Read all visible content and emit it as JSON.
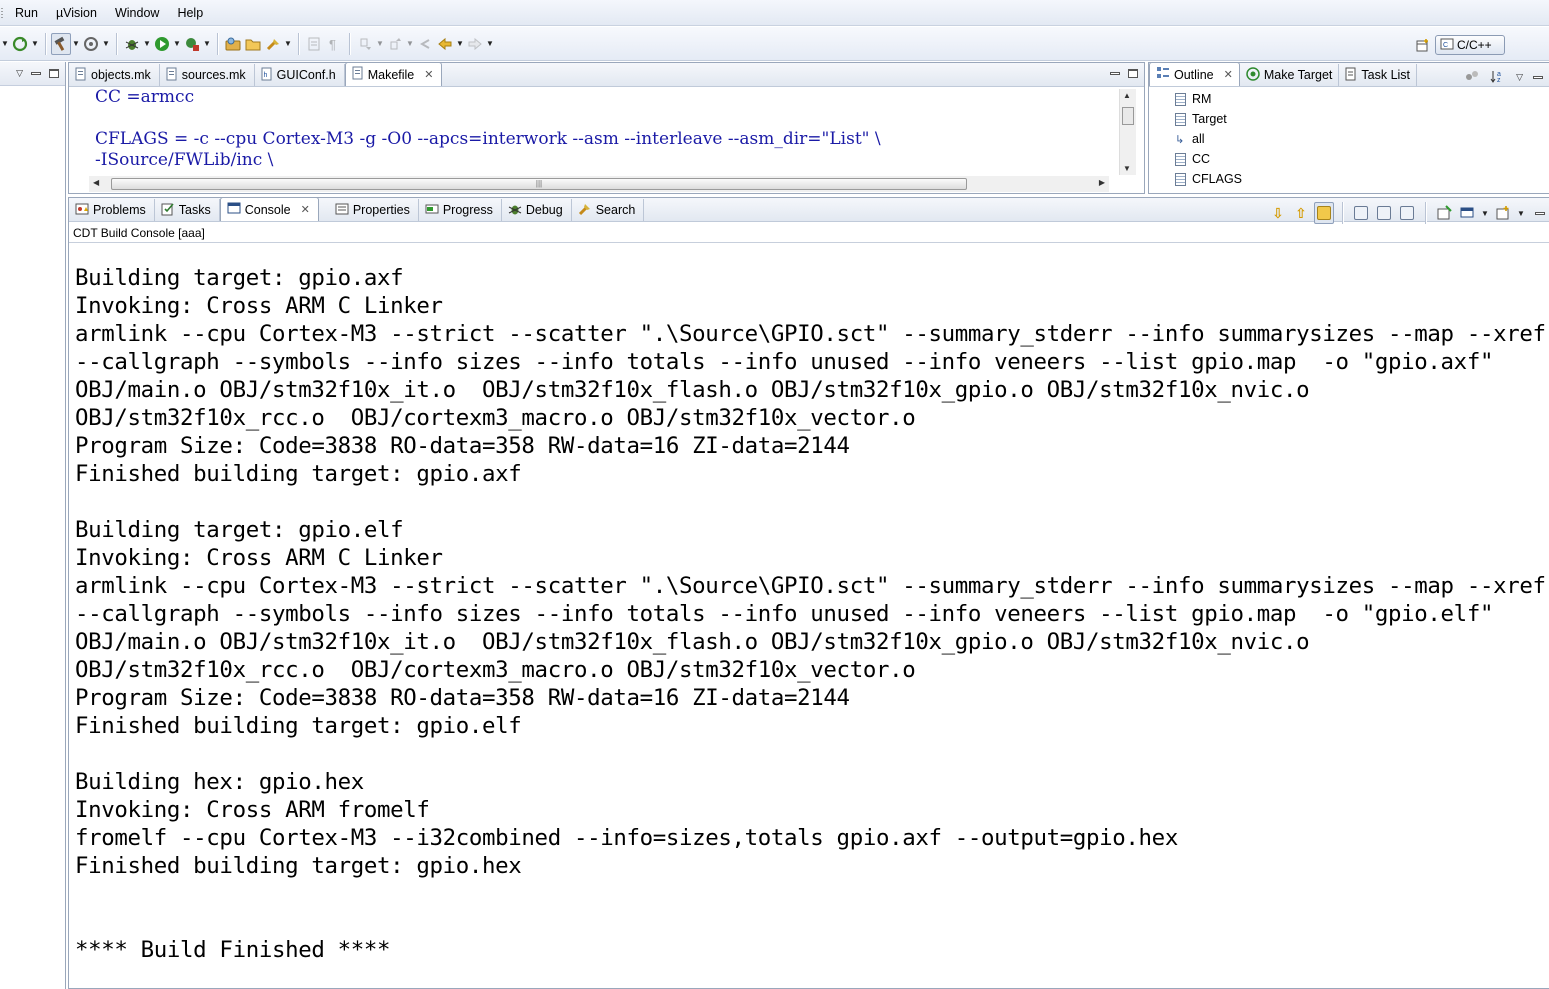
{
  "menu": [
    "Run",
    "µVision",
    "Window",
    "Help"
  ],
  "perspective": {
    "label": "C/C++"
  },
  "editor": {
    "tabs": [
      {
        "label": "objects.mk",
        "active": false
      },
      {
        "label": "sources.mk",
        "active": false
      },
      {
        "label": "GUIConf.h",
        "active": false
      },
      {
        "label": "Makefile",
        "active": true
      }
    ],
    "lines": [
      "CC =armcc",
      "",
      "CFLAGS = -c --cpu Cortex-M3 -g -O0 --apcs=interwork --asm --interleave --asm_dir=\"List\" \\",
      "-ISource/FWLib/inc \\"
    ]
  },
  "outline": {
    "tabs": [
      {
        "label": "Outline",
        "active": true
      },
      {
        "label": "Make Target",
        "active": false
      },
      {
        "label": "Task List",
        "active": false
      }
    ],
    "items": [
      "RM",
      "Target",
      "all",
      "CC",
      "CFLAGS"
    ]
  },
  "console": {
    "tabs": [
      {
        "label": "Problems",
        "active": false
      },
      {
        "label": "Tasks",
        "active": false
      },
      {
        "label": "Console",
        "active": true
      },
      {
        "label": "Properties",
        "active": false
      },
      {
        "label": "Progress",
        "active": false
      },
      {
        "label": "Debug",
        "active": false
      },
      {
        "label": "Search",
        "active": false
      }
    ],
    "title": "CDT Build Console [aaa]",
    "lines": [
      "Building target: gpio.axf",
      "Invoking: Cross ARM C Linker",
      "armlink --cpu Cortex-M3 --strict --scatter \".\\Source\\GPIO.sct\" --summary_stderr --info summarysizes --map --xref",
      "--callgraph --symbols --info sizes --info totals --info unused --info veneers --list gpio.map  -o \"gpio.axf\"",
      "OBJ/main.o OBJ/stm32f10x_it.o  OBJ/stm32f10x_flash.o OBJ/stm32f10x_gpio.o OBJ/stm32f10x_nvic.o",
      "OBJ/stm32f10x_rcc.o  OBJ/cortexm3_macro.o OBJ/stm32f10x_vector.o",
      "Program Size: Code=3838 RO-data=358 RW-data=16 ZI-data=2144",
      "Finished building target: gpio.axf",
      "",
      "Building target: gpio.elf",
      "Invoking: Cross ARM C Linker",
      "armlink --cpu Cortex-M3 --strict --scatter \".\\Source\\GPIO.sct\" --summary_stderr --info summarysizes --map --xref",
      "--callgraph --symbols --info sizes --info totals --info unused --info veneers --list gpio.map  -o \"gpio.elf\"",
      "OBJ/main.o OBJ/stm32f10x_it.o  OBJ/stm32f10x_flash.o OBJ/stm32f10x_gpio.o OBJ/stm32f10x_nvic.o",
      "OBJ/stm32f10x_rcc.o  OBJ/cortexm3_macro.o OBJ/stm32f10x_vector.o",
      "Program Size: Code=3838 RO-data=358 RW-data=16 ZI-data=2144",
      "Finished building target: gpio.elf",
      "",
      "Building hex: gpio.hex",
      "Invoking: Cross ARM fromelf",
      "fromelf --cpu Cortex-M3 --i32combined --info=sizes,totals gpio.axf --output=gpio.hex",
      "Finished building target: gpio.hex",
      "",
      "",
      "**** Build Finished ****"
    ]
  },
  "colors": {
    "code_keyword": "#1a1aa6",
    "console_text": "#000000",
    "chrome_gradient_top": "#f5f7fb",
    "chrome_gradient_bottom": "#e2e8f1",
    "border": "#9aa7bb"
  }
}
